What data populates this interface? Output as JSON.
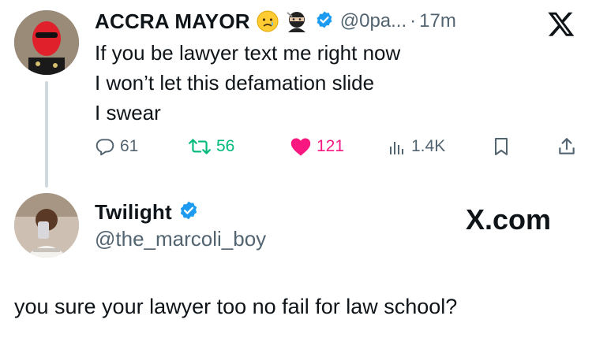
{
  "tweet": {
    "author_name": "ACCRA MAYOR",
    "handle": "@0pa...",
    "separator": "·",
    "time": "17m",
    "lines": [
      "If you be lawyer text me right now",
      "I won’t let this defamation slide",
      "I swear"
    ],
    "stats": {
      "replies": "61",
      "retweets": "56",
      "likes": "121",
      "views": "1.4K"
    }
  },
  "quote": {
    "author_name": "Twilight",
    "handle": "@the_marcoli_boy",
    "watermark": "X.com",
    "reply_text": "you sure your lawyer too no fail for law school?"
  },
  "colors": {
    "text": "#0f1419",
    "muted": "#536471",
    "retweet": "#00ba7c",
    "like": "#f91880",
    "verified": "#1d9bf0",
    "thread_line": "#cfd9de"
  },
  "icons": {
    "emoji_1": "crying-face-icon",
    "emoji_2": "ninja-icon",
    "x_logo": "x-logo-icon"
  }
}
